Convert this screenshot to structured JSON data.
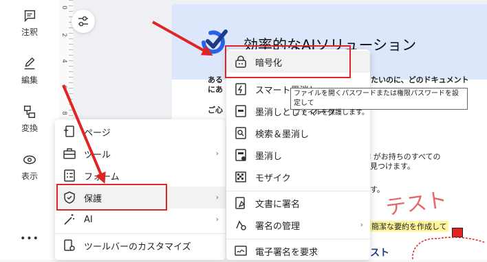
{
  "rail": {
    "items": [
      {
        "label": "注釈",
        "icon": "comment-icon"
      },
      {
        "label": "編集",
        "icon": "edit-icon"
      },
      {
        "label": "変換",
        "icon": "convert-icon"
      },
      {
        "label": "表示",
        "icon": "eye-icon"
      }
    ],
    "more": "•••"
  },
  "ruler": {
    "numbers": [
      "0",
      "2",
      "4",
      "6",
      "8"
    ]
  },
  "document": {
    "title": "効率的なAIソリューション",
    "line1_left": "ある",
    "line1_right": "たいのに、どのドキュメント",
    "line2_left": "にあ",
    "line3_left": "ご心",
    "body1": "I がお持ちのすべての",
    "body2": "見つけます。",
    "body3": "す。",
    "handwriting": "テスト",
    "highlight": "簡潔な要約を作成して",
    "footer": "スト"
  },
  "menu1": {
    "items": [
      {
        "label": "ページ",
        "icon": "page-icon",
        "submenu": false
      },
      {
        "label": "ツール",
        "icon": "toolbox-icon",
        "submenu": true
      },
      {
        "label": "フォーム",
        "icon": "form-icon",
        "submenu": false
      },
      {
        "label": "保護",
        "icon": "shield-icon",
        "submenu": true
      },
      {
        "label": "AI",
        "icon": "magic-wand-icon",
        "submenu": true
      },
      {
        "label": "ツールバーのカスタマイズ",
        "icon": "customize-toolbar-icon",
        "submenu": false
      }
    ]
  },
  "menu2": {
    "items": [
      {
        "label": "暗号化",
        "icon": "lock-icon"
      },
      {
        "label": "スマート墨消し",
        "icon": "smart-redact-icon"
      },
      {
        "label": "墨消しとしてマーク",
        "icon": "mark-redact-icon"
      },
      {
        "label": "検索＆墨消し",
        "icon": "search-redact-icon"
      },
      {
        "label": "墨消し",
        "icon": "redact-icon"
      },
      {
        "label": "モザイク",
        "icon": "mosaic-icon"
      },
      {
        "label": "文書に署名",
        "icon": "sign-document-icon"
      },
      {
        "label": "署名の管理",
        "icon": "manage-signature-icon"
      },
      {
        "label": "電子署名を要求",
        "icon": "request-esign-icon"
      }
    ]
  },
  "tooltip": {
    "line1": "ファイルを開くパスワードまたは権限パスワードを設定して",
    "line2": "ファイルを保護します。"
  },
  "colors": {
    "accent": "#2563eb",
    "annotation_red": "#e02424",
    "highlight": "#fff59d"
  }
}
